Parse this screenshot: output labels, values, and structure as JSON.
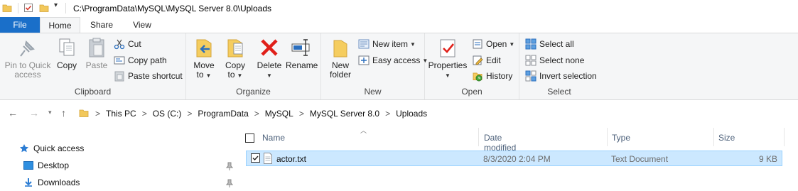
{
  "window": {
    "title": "C:\\ProgramData\\MySQL\\MySQL Server 8.0\\Uploads"
  },
  "ribbon_tabs": {
    "file": "File",
    "home": "Home",
    "share": "Share",
    "view": "View"
  },
  "clipboard": {
    "group": "Clipboard",
    "pin_line1": "Pin to Quick",
    "pin_line2": "access",
    "copy": "Copy",
    "paste": "Paste",
    "cut": "Cut",
    "copy_path": "Copy path",
    "paste_shortcut": "Paste shortcut"
  },
  "organize": {
    "group": "Organize",
    "move_line1": "Move",
    "move_line2": "to",
    "copy_line1": "Copy",
    "copy_line2": "to",
    "delete": "Delete",
    "rename": "Rename"
  },
  "new": {
    "group": "New",
    "folder_line1": "New",
    "folder_line2": "folder",
    "new_item": "New item",
    "easy_access": "Easy access"
  },
  "open": {
    "group": "Open",
    "properties": "Properties",
    "open": "Open",
    "edit": "Edit",
    "history": "History"
  },
  "select": {
    "group": "Select",
    "select_all": "Select all",
    "select_none": "Select none",
    "invert": "Invert selection"
  },
  "breadcrumb": [
    "This PC",
    "OS (C:)",
    "ProgramData",
    "MySQL",
    "MySQL Server 8.0",
    "Uploads"
  ],
  "navpane": {
    "quick_access": "Quick access",
    "desktop": "Desktop",
    "downloads": "Downloads"
  },
  "columns": {
    "name": "Name",
    "date": "Date modified",
    "type": "Type",
    "size": "Size"
  },
  "files": [
    {
      "name": "actor.txt",
      "date": "8/3/2020 2:04 PM",
      "type": "Text Document",
      "size": "9 KB"
    }
  ],
  "colors": {
    "file_tab": "#1a6fc9",
    "selection": "#cce8ff",
    "selection_border": "#99d1ff"
  }
}
